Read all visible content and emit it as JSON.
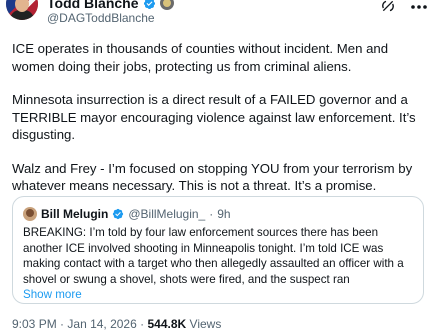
{
  "author": {
    "name": "Todd Blanche",
    "handle": "@DAGToddBlanche"
  },
  "tweet": {
    "paragraphs": [
      "ICE operates in thousands of counties without incident. Men and women doing their jobs, protecting us from criminal aliens.",
      "Minnesota insurrection is a direct result of a FAILED governor and a TERRIBLE mayor encouraging violence against law enforcement. It’s disgusting.",
      "Walz and Frey - I’m focused on stopping YOU from your terrorism by whatever means necessary. This is not a threat. It’s a promise."
    ]
  },
  "quoted": {
    "name": "Bill Melugin",
    "handle": "@BillMelugin_",
    "separator": "·",
    "time": "9h",
    "text": "BREAKING: I’m told by four law enforcement sources there has been another ICE involved shooting in Minneapolis tonight. I’m told ICE was making contact with a target who then allegedly assaulted an officer with a shovel or swung a shovel, shots were fired, and the suspect ran",
    "show_more": "Show more"
  },
  "meta": {
    "time": "9:03 PM",
    "separator1": "·",
    "date": "Jan 14, 2026",
    "separator2": "·",
    "views_count": "544.8K",
    "views_label": "Views"
  },
  "colors": {
    "verified_blue": "#1d9bf0",
    "secondary_text": "#536471",
    "border": "#cfd9de"
  }
}
